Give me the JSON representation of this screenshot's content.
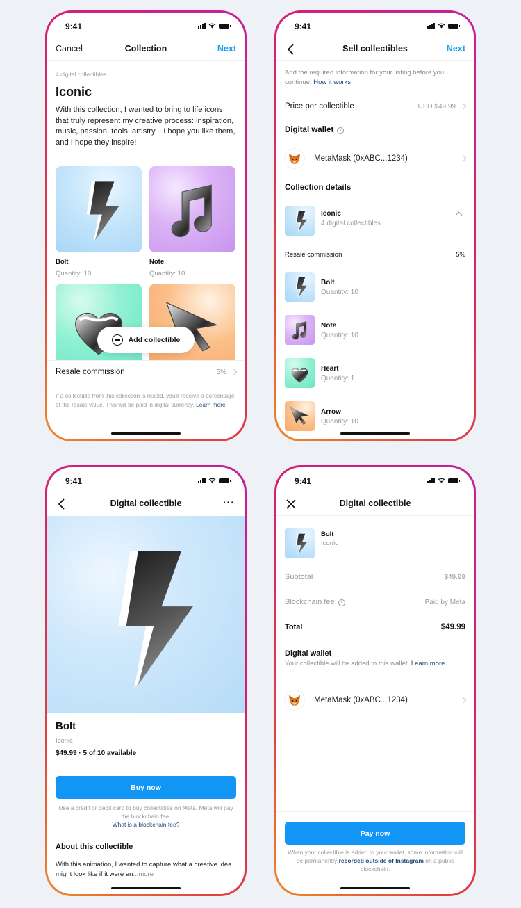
{
  "status": {
    "time": "9:41"
  },
  "screen1": {
    "nav": {
      "left": "Cancel",
      "title": "Collection",
      "right": "Next"
    },
    "count": "4 digital collectibles",
    "title": "Iconic",
    "description": "With this collection, I wanted to bring to life icons that truly represent my creative process: inspiration, music, passion, tools, artistry... I hope you like them, and I hope they inspire!",
    "items": [
      {
        "name": "Bolt",
        "qty": "Quantity: 10"
      },
      {
        "name": "Note",
        "qty": "Quantity: 10"
      },
      {
        "name": "Heart",
        "qty": ""
      },
      {
        "name": "Arrow",
        "qty": ""
      }
    ],
    "add_button": "Add collectible",
    "resale_label": "Resale commission",
    "resale_value": "5%",
    "fineprint": "If a collectible from this collection is resold, you'll receive a percentage of the resale value. This will be paid in digital currency.",
    "learn_more": "Learn more"
  },
  "screen2": {
    "nav": {
      "title": "Sell collectibles",
      "right": "Next"
    },
    "intro": "Add the required information for your listing before you continue.",
    "how_it_works": "How it works",
    "price_label": "Price per collectible",
    "price_value": "USD $49.99",
    "wallet_title": "Digital wallet",
    "wallet_name": "MetaMask (0xABC...1234)",
    "details_title": "Collection details",
    "collection_name": "Iconic",
    "collection_count": "4 digital collectibles",
    "resale_label": "Resale commission",
    "resale_value": "5%",
    "items": [
      {
        "name": "Bolt",
        "qty": "Quantity: 10"
      },
      {
        "name": "Note",
        "qty": "Quantity: 10"
      },
      {
        "name": "Heart",
        "qty": "Quantity: 1"
      },
      {
        "name": "Arrow",
        "qty": "Quantity: 10"
      }
    ]
  },
  "screen3": {
    "nav": {
      "title": "Digital collectible",
      "more": "···"
    },
    "name": "Bolt",
    "collection": "Iconic",
    "price_line": "$49.99 · 5 of 10 available",
    "buy_button": "Buy now",
    "buy_note": "Use a credit or debit card to buy collectibles on Meta. Meta will pay the blockchain fee.",
    "fee_link": "What is a blockchain fee?",
    "about_title": "About this collectible",
    "about_text": "With this animation, I wanted to capture what a creative idea might look like if it were an",
    "more_link": "...more"
  },
  "screen4": {
    "nav": {
      "title": "Digital collectible"
    },
    "item_name": "Bolt",
    "item_collection": "Iconic",
    "subtotal_label": "Subtotal",
    "subtotal_value": "$49.99",
    "fee_label": "Blockchain fee",
    "fee_value": "Paid by Meta",
    "total_label": "Total",
    "total_value": "$49.99",
    "wallet_title": "Digital wallet",
    "wallet_note": "Your collectible will be added to this wallet.",
    "learn_more": "Learn more",
    "wallet_name": "MetaMask (0xABC...1234)",
    "pay_button": "Pay now",
    "pay_note_1": "When your collectible is added to your wallet, some information will be permanently",
    "pay_link": "recorded outside of Instagram",
    "pay_note_2": "on a public blockchain."
  },
  "colors": {
    "accent": "#1196f5",
    "link": "#224b7c",
    "frame_gradient": [
      "#c3219a",
      "#d4206f",
      "#e0423f",
      "#ef8a2a"
    ]
  }
}
